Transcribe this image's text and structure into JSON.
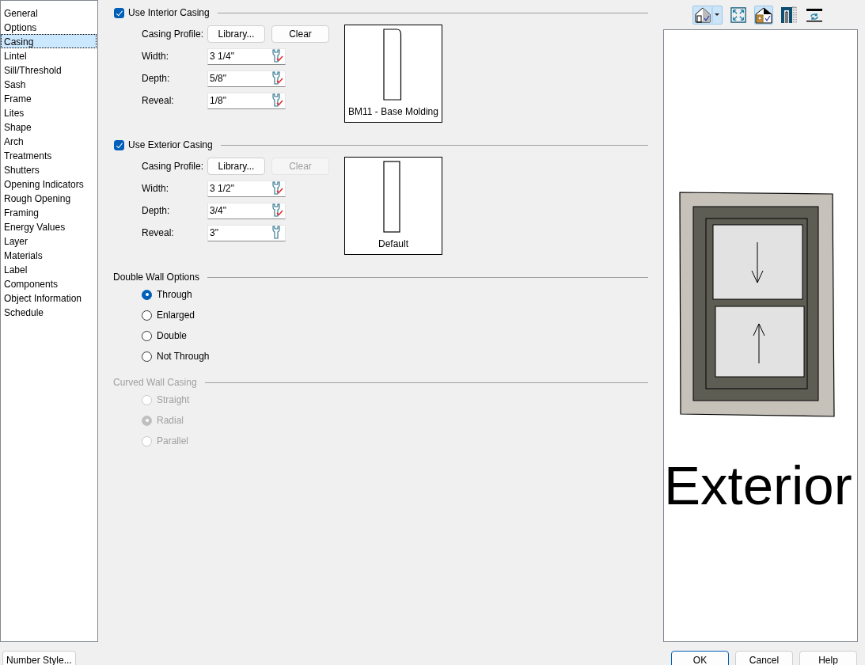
{
  "sidebar": {
    "items": [
      {
        "label": "General",
        "selected": false
      },
      {
        "label": "Options",
        "selected": false
      },
      {
        "label": "Casing",
        "selected": true
      },
      {
        "label": "Lintel",
        "selected": false
      },
      {
        "label": "Sill/Threshold",
        "selected": false
      },
      {
        "label": "Sash",
        "selected": false
      },
      {
        "label": "Frame",
        "selected": false
      },
      {
        "label": "Lites",
        "selected": false
      },
      {
        "label": "Shape",
        "selected": false
      },
      {
        "label": "Arch",
        "selected": false
      },
      {
        "label": "Treatments",
        "selected": false
      },
      {
        "label": "Shutters",
        "selected": false
      },
      {
        "label": "Opening Indicators",
        "selected": false
      },
      {
        "label": "Rough Opening",
        "selected": false
      },
      {
        "label": "Framing",
        "selected": false
      },
      {
        "label": "Energy Values",
        "selected": false
      },
      {
        "label": "Layer",
        "selected": false
      },
      {
        "label": "Materials",
        "selected": false
      },
      {
        "label": "Label",
        "selected": false
      },
      {
        "label": "Components",
        "selected": false
      },
      {
        "label": "Object Information",
        "selected": false
      },
      {
        "label": "Schedule",
        "selected": false
      }
    ]
  },
  "sections": [
    {
      "kind": "casing",
      "title": "Use Interior Casing",
      "checked": true,
      "profile_label": "Casing Profile:",
      "buttons": [
        {
          "label": "Library...",
          "disabled": false
        },
        {
          "label": "Clear",
          "disabled": false
        }
      ],
      "fields": [
        {
          "label": "Width:",
          "value": "3 1/4\"",
          "checked": true
        },
        {
          "label": "Depth:",
          "value": "5/8\"",
          "checked": true
        },
        {
          "label": "Reveal:",
          "value": "1/8\"",
          "checked": true
        }
      ],
      "profile_rounded": true,
      "preview_caption": "BM11 - Base Molding"
    },
    {
      "kind": "casing",
      "title": "Use Exterior Casing",
      "checked": true,
      "profile_label": "Casing Profile:",
      "buttons": [
        {
          "label": "Library...",
          "disabled": false
        },
        {
          "label": "Clear",
          "disabled": true
        }
      ],
      "fields": [
        {
          "label": "Width:",
          "value": "3 1/2\"",
          "checked": true
        },
        {
          "label": "Depth:",
          "value": "3/4\"",
          "checked": true
        },
        {
          "label": "Reveal:",
          "value": "3\"",
          "checked": false
        }
      ],
      "profile_rounded": false,
      "preview_caption": "Default"
    },
    {
      "kind": "radio-group",
      "title": "Double Wall Options",
      "disabled": false,
      "options": [
        {
          "label": "Through",
          "selected": true
        },
        {
          "label": "Enlarged",
          "selected": false
        },
        {
          "label": "Double",
          "selected": false
        },
        {
          "label": "Not Through",
          "selected": false
        }
      ]
    },
    {
      "kind": "radio-group",
      "title": "Curved Wall Casing",
      "disabled": true,
      "options": [
        {
          "label": "Straight",
          "selected": false
        },
        {
          "label": "Radial",
          "selected": true
        },
        {
          "label": "Parallel",
          "selected": false
        }
      ]
    }
  ],
  "preview": {
    "toolbar": [
      {
        "kind": "view",
        "selected": true
      },
      {
        "kind": "fit",
        "selected": false
      },
      {
        "kind": "materials",
        "selected": true
      },
      {
        "kind": "casing",
        "selected": false
      },
      {
        "kind": "refresh",
        "selected": false
      }
    ],
    "caption": "Exterior"
  },
  "footer": {
    "left_button": "Number Style...",
    "buttons": [
      {
        "label": "OK",
        "default": true
      },
      {
        "label": "Cancel",
        "default": false
      },
      {
        "label": "Help",
        "default": false
      }
    ]
  }
}
